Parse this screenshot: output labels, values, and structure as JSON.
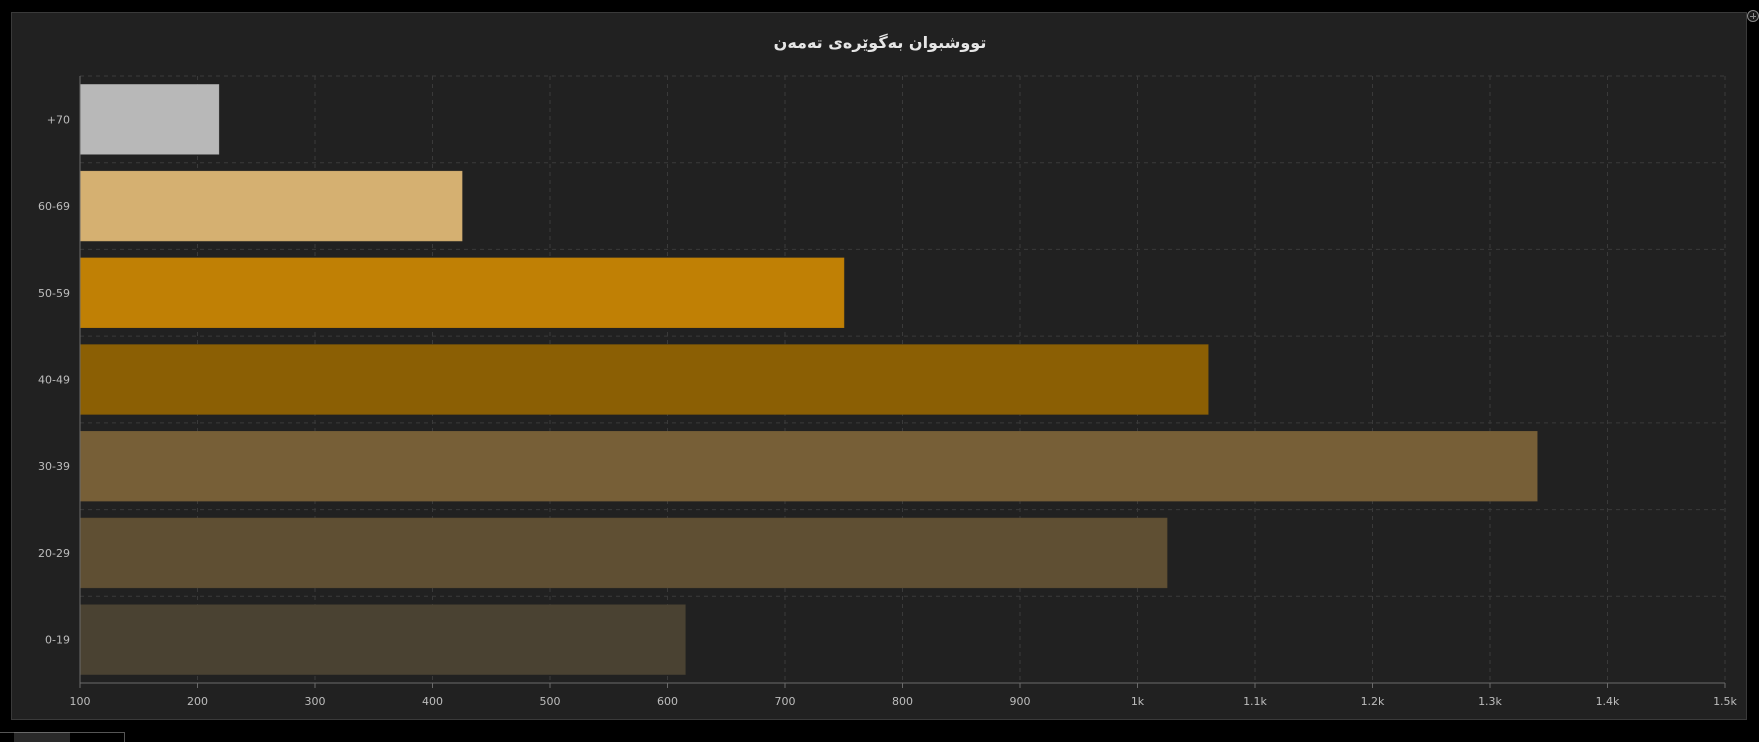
{
  "chart_data": {
    "type": "bar",
    "orientation": "horizontal",
    "title": "تووشبوان بەگوێرەی تەمەن",
    "categories": [
      "0-19",
      "20-29",
      "30-39",
      "40-49",
      "50-59",
      "60-69",
      "+70"
    ],
    "values": [
      615,
      1025,
      1340,
      1060,
      750,
      425,
      218
    ],
    "bar_colors": [
      "#4a4232",
      "#5f4f33",
      "#775f37",
      "#8b5f04",
      "#c08005",
      "#d5b071",
      "#b8b8b8"
    ],
    "xlim": [
      100,
      1500
    ],
    "x_ticks": [
      100,
      200,
      300,
      400,
      500,
      600,
      700,
      800,
      900,
      1000,
      1100,
      1200,
      1300,
      1400,
      1500
    ],
    "x_tick_labels": [
      "100",
      "200",
      "300",
      "400",
      "500",
      "600",
      "700",
      "800",
      "900",
      "1k",
      "1.1k",
      "1.2k",
      "1.3k",
      "1.4k",
      "1.5k"
    ],
    "xlabel": "",
    "ylabel": "",
    "grid": true,
    "legend": "none"
  },
  "colors": {
    "background": "#212121",
    "grid": "#3a3a3a",
    "axis": "#6a6a6a",
    "tick_text": "#bdbdbd",
    "title_text": "#e6e6e6"
  },
  "icons": {
    "expand": "expand-icon"
  }
}
